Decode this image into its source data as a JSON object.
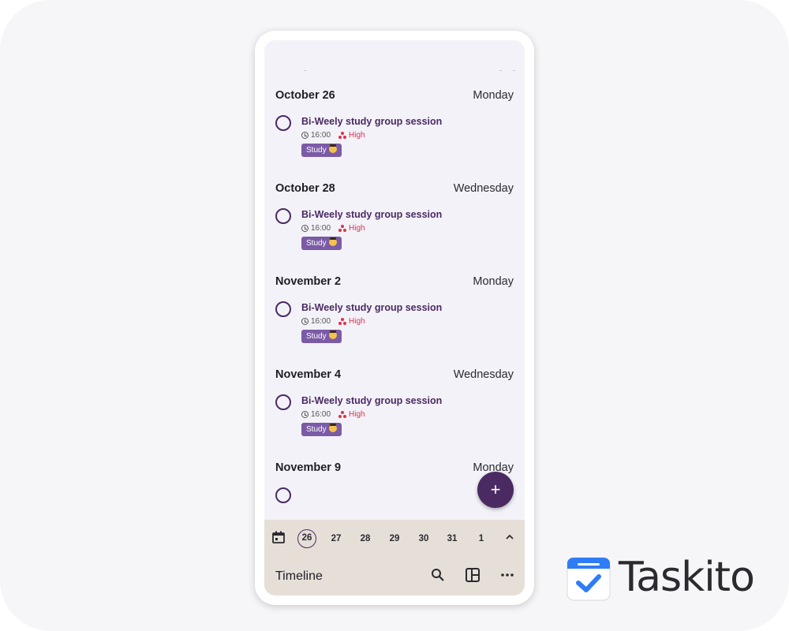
{
  "colors": {
    "accent": "#4b2a63",
    "tag": "#7b5aa6",
    "priority_high": "#e0304a",
    "bottom_bar": "#e6dfd8"
  },
  "days": [
    {
      "date": "October 26",
      "weekday": "Monday",
      "task": {
        "title": "Bi-Weely study group session",
        "time": "16:00",
        "priority": "High",
        "tag": "Study"
      }
    },
    {
      "date": "October 28",
      "weekday": "Wednesday",
      "task": {
        "title": "Bi-Weely study group session",
        "time": "16:00",
        "priority": "High",
        "tag": "Study"
      }
    },
    {
      "date": "November 2",
      "weekday": "Monday",
      "task": {
        "title": "Bi-Weely study group session",
        "time": "16:00",
        "priority": "High",
        "tag": "Study"
      }
    },
    {
      "date": "November 4",
      "weekday": "Wednesday",
      "task": {
        "title": "Bi-Weely study group session",
        "time": "16:00",
        "priority": "High",
        "tag": "Study"
      }
    },
    {
      "date": "November 9",
      "weekday": "Monday"
    }
  ],
  "fab": {
    "label": "+"
  },
  "date_strip": {
    "dates": [
      "26",
      "27",
      "28",
      "29",
      "30",
      "31",
      "1"
    ],
    "selected": "26"
  },
  "toolbar": {
    "title": "Timeline",
    "icons": [
      "search-icon",
      "layout-icon",
      "more-icon"
    ]
  },
  "nav": {
    "icons": [
      "back-icon",
      "home-icon",
      "recents-icon"
    ]
  },
  "brand": {
    "name": "Taskito"
  }
}
